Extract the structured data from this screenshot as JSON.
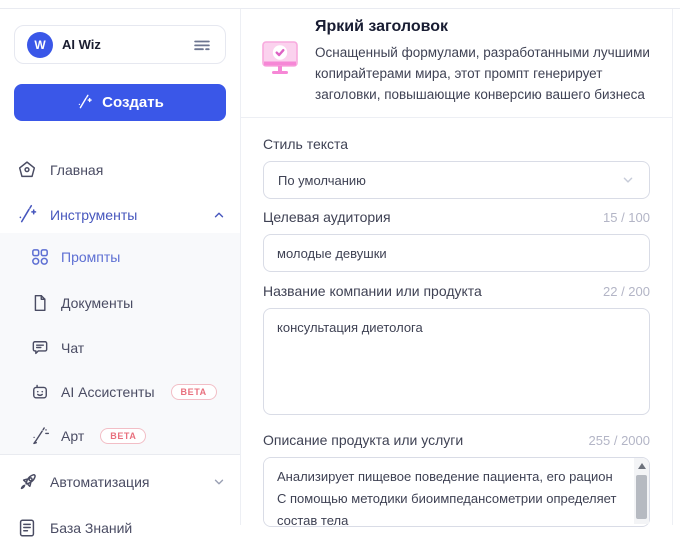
{
  "app": {
    "brand": "AI Wiz",
    "logo_letter": "W"
  },
  "sidebar": {
    "create_button": "Создать",
    "nav": [
      {
        "label": "Главная"
      },
      {
        "label": "Инструменты"
      },
      {
        "label": "Промпты"
      },
      {
        "label": "Документы"
      },
      {
        "label": "Чат"
      },
      {
        "label": "AI Ассистенты",
        "badge": "BETA"
      },
      {
        "label": "Арт",
        "badge": "BETA"
      },
      {
        "label": "Автоматизация"
      },
      {
        "label": "База Знаний"
      }
    ]
  },
  "header": {
    "title": "Яркий заголовок",
    "description": "Оснащенный формулами, разработанными лучшими копирайтерами мира, этот промпт генерирует заголовки, повышающие конверсию вашего бизнеса"
  },
  "form": {
    "style": {
      "label": "Стиль текста",
      "value": "По умолчанию"
    },
    "audience": {
      "label": "Целевая аудитория",
      "counter": "15 / 100",
      "value": "молодые девушки"
    },
    "company": {
      "label": "Название компании или продукта",
      "counter": "22 / 200",
      "value": "консультация диетолога"
    },
    "product": {
      "label": "Описание продукта или услуги",
      "counter": "255 / 2000",
      "value": "Анализирует пищевое поведение пациента, его рацион\nС помощью методики биоимпедансометрии определяет состав тела"
    }
  },
  "colors": {
    "primary": "#3a57e8",
    "nav_active": "#5d6fd3",
    "beta": "#e8707e",
    "icon_pink": "#f687d6"
  }
}
